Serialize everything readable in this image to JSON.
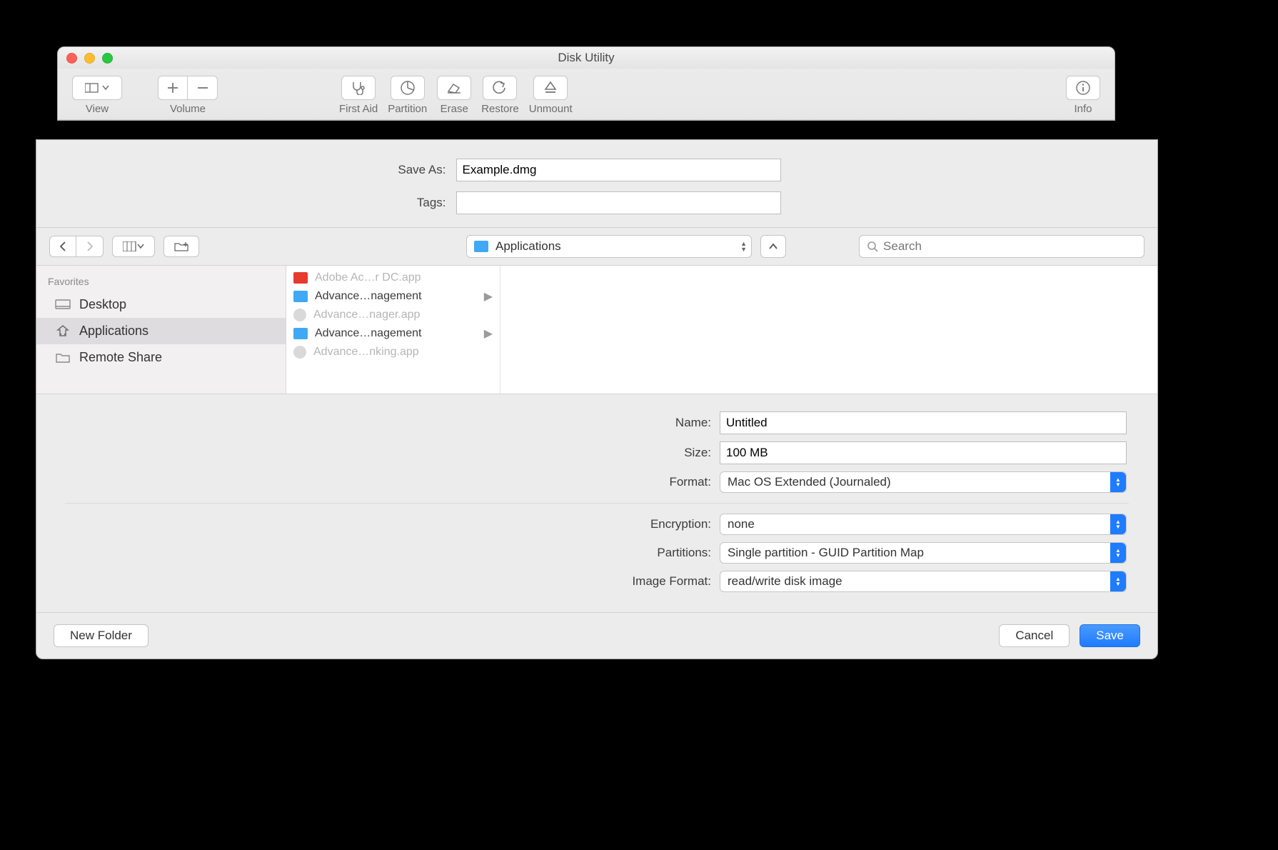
{
  "window": {
    "title": "Disk Utility",
    "toolbar": {
      "view": "View",
      "volume": "Volume",
      "first_aid": "First Aid",
      "partition": "Partition",
      "erase": "Erase",
      "restore": "Restore",
      "unmount": "Unmount",
      "info": "Info"
    }
  },
  "sheet": {
    "save_as_label": "Save As:",
    "save_as_value": "Example.dmg",
    "tags_label": "Tags:",
    "location_label": "Applications",
    "search_placeholder": "Search",
    "sidebar_header": "Favorites",
    "sidebar_items": [
      {
        "label": "Desktop",
        "selected": false
      },
      {
        "label": "Applications",
        "selected": true
      },
      {
        "label": "Remote Share",
        "selected": false
      }
    ],
    "file_list": [
      {
        "label": "Adobe Ac…r DC.app",
        "kind": "pdf",
        "dim": true,
        "arrow": false
      },
      {
        "label": "Advance…nagement",
        "kind": "folder",
        "dim": false,
        "arrow": true
      },
      {
        "label": "Advance…nager.app",
        "kind": "globe",
        "dim": true,
        "arrow": false
      },
      {
        "label": "Advance…nagement",
        "kind": "folder",
        "dim": false,
        "arrow": true
      },
      {
        "label": "Advance…nking.app",
        "kind": "globe",
        "dim": true,
        "arrow": false
      }
    ],
    "options": {
      "name_label": "Name:",
      "name_value": "Untitled",
      "size_label": "Size:",
      "size_value": "100 MB",
      "format_label": "Format:",
      "format_value": "Mac OS Extended (Journaled)",
      "encryption_label": "Encryption:",
      "encryption_value": "none",
      "partitions_label": "Partitions:",
      "partitions_value": "Single partition - GUID Partition Map",
      "image_format_label": "Image Format:",
      "image_format_value": "read/write disk image"
    },
    "footer": {
      "new_folder": "New Folder",
      "cancel": "Cancel",
      "save": "Save"
    }
  }
}
